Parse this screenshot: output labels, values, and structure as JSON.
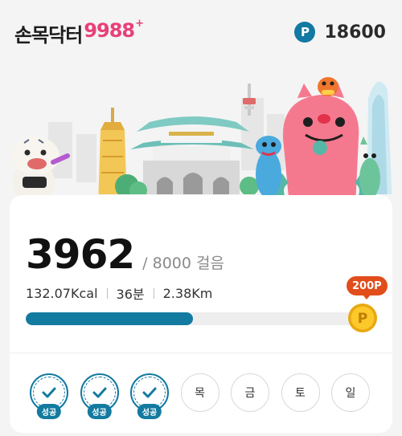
{
  "header": {
    "logo_text": "손목닥터",
    "logo_num": "9988",
    "logo_plus": "+",
    "point_icon": "P",
    "points": "18600"
  },
  "steps": {
    "value": "3962",
    "goal": "/ 8000 걸음",
    "progress_fraction": 0.4953
  },
  "stats": {
    "kcal": "132.07Kcal",
    "minutes": "36분",
    "distance": "2.38Km"
  },
  "reward": {
    "label": "200P",
    "coin_icon": "P"
  },
  "week": {
    "days": [
      {
        "label": "성공",
        "done": true
      },
      {
        "label": "성공",
        "done": true
      },
      {
        "label": "성공",
        "done": true
      },
      {
        "label": "목",
        "done": false
      },
      {
        "label": "금",
        "done": false
      },
      {
        "label": "토",
        "done": false
      },
      {
        "label": "일",
        "done": false
      }
    ]
  },
  "colors": {
    "brand_blue": "#137aa0",
    "logo_pink": "#e8407a",
    "reward_red": "#e14d1b"
  }
}
